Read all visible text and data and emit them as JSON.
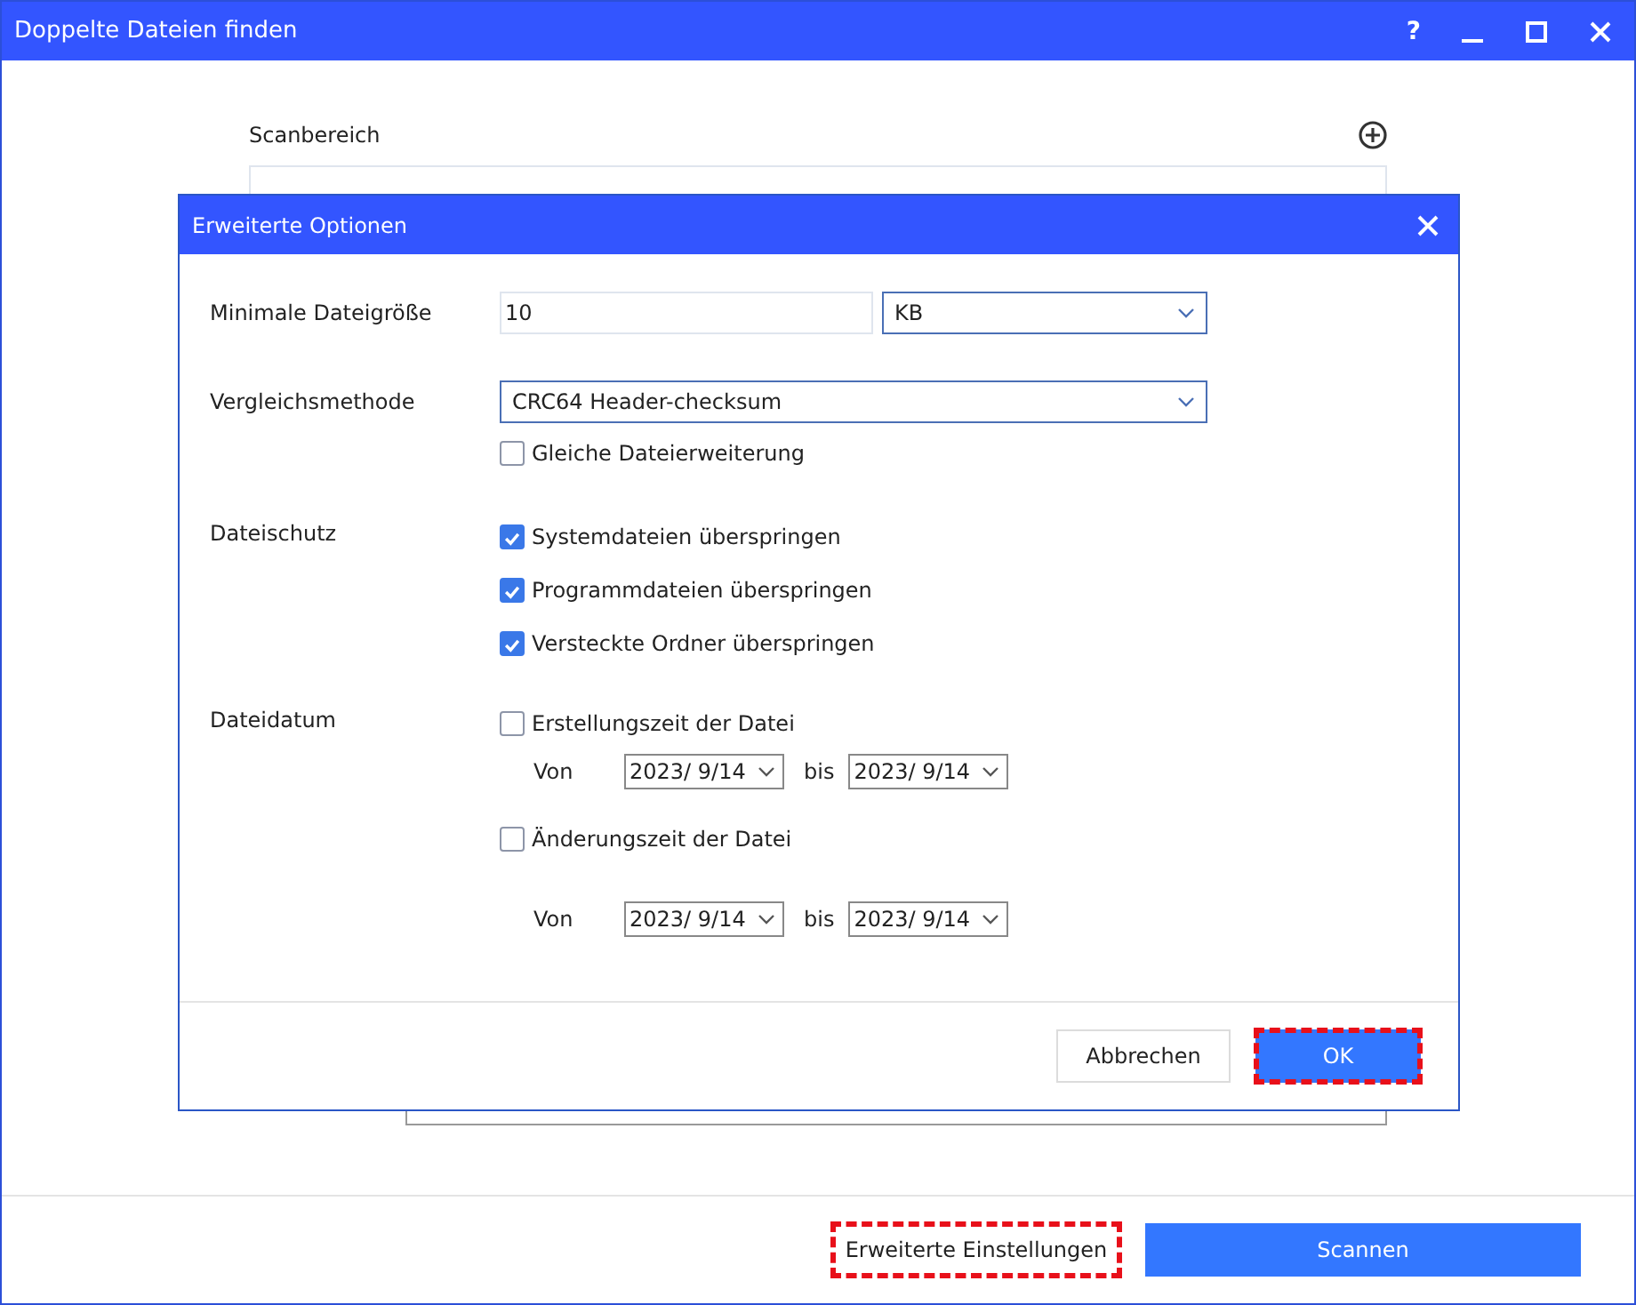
{
  "window": {
    "title": "Doppelte Dateien finden",
    "controls": [
      "?"
    ]
  },
  "scan_area": {
    "label": "Scanbereich"
  },
  "footer": {
    "buttons": [
      {
        "label": "Erweiterte Einstellungen",
        "kind": "secondary",
        "highlighted": true
      },
      {
        "label": "Scannen",
        "kind": "primary",
        "highlighted": false
      }
    ]
  },
  "dialog": {
    "title": "Erweiterte Optionen",
    "min_size": {
      "label": "Minimale Dateigröße",
      "value": "10",
      "unit": "KB"
    },
    "compare": {
      "label": "Vergleichsmethode",
      "value": "CRC64 Header-checksum",
      "option": {
        "label": "Gleiche Dateierweiterung",
        "checked": false
      }
    },
    "protection": {
      "label": "Dateischutz",
      "options": [
        {
          "label": "Systemdateien überspringen",
          "checked": true
        },
        {
          "label": "Programmdateien überspringen",
          "checked": true
        },
        {
          "label": "Versteckte Ordner überspringen",
          "checked": true
        }
      ]
    },
    "date": {
      "label": "Dateidatum",
      "groups": [
        {
          "label": "Erstellungszeit der Datei",
          "checked": false,
          "from_label": "Von",
          "from": "2023/ 9/14",
          "to_label": "bis",
          "to": "2023/ 9/14"
        },
        {
          "label": "Änderungszeit der Datei",
          "checked": false,
          "from_label": "Von",
          "from": "2023/ 9/14",
          "to_label": "bis",
          "to": "2023/ 9/14"
        }
      ]
    },
    "buttons": [
      {
        "label": "Abbrechen",
        "kind": "secondary",
        "highlighted": false
      },
      {
        "label": "OK",
        "kind": "primary",
        "highlighted": true
      }
    ]
  }
}
